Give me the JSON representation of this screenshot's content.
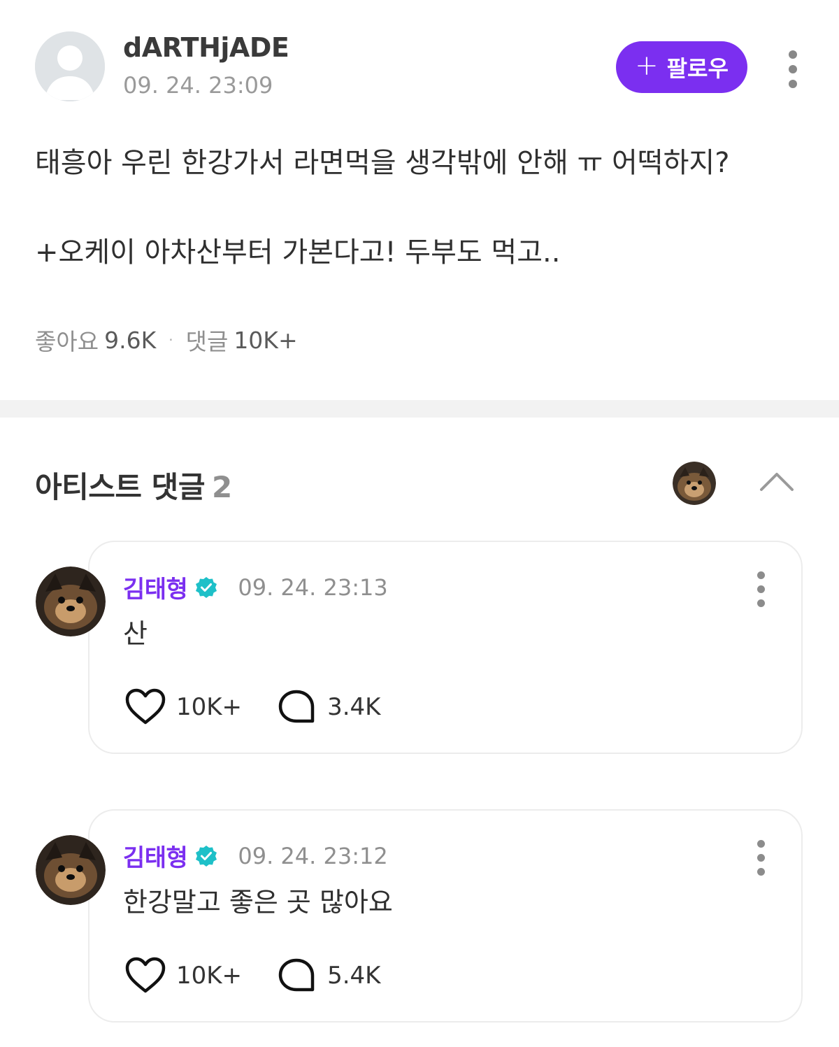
{
  "post": {
    "author": "dARTHjADE",
    "timestamp": "09. 24. 23:09",
    "follow_label": "팔로우",
    "follow_plus": "+",
    "body_line1": "태흥아 우린 한강가서 라면먹을 생각밖에 안해 ㅠ 어떡하지?",
    "body_line2": "+오케이 아차산부터 가본다고! 두부도 먹고..",
    "likes_label": "좋아요",
    "likes_value": "9.6K",
    "separator": "·",
    "comments_label": "댓글",
    "comments_value": "10K+"
  },
  "artist_section": {
    "title": "아티스트 댓글",
    "count": "2"
  },
  "comments": [
    {
      "author": "김태형",
      "timestamp": "09. 24. 23:13",
      "text": "산",
      "likes": "10K+",
      "replies": "3.4K"
    },
    {
      "author": "김태형",
      "timestamp": "09. 24. 23:12",
      "text": "한강말고 좋은 곳 많아요",
      "likes": "10K+",
      "replies": "5.4K"
    }
  ],
  "colors": {
    "accent": "#7b2ff0",
    "verified": "#1ec0c8",
    "muted": "#8f8f8f",
    "divider": "#f2f2f2"
  },
  "icons": [
    "default-avatar-icon",
    "plus-icon",
    "more-vert-icon",
    "chevron-up-icon",
    "verified-badge-icon",
    "heart-icon",
    "comment-bubble-icon"
  ]
}
